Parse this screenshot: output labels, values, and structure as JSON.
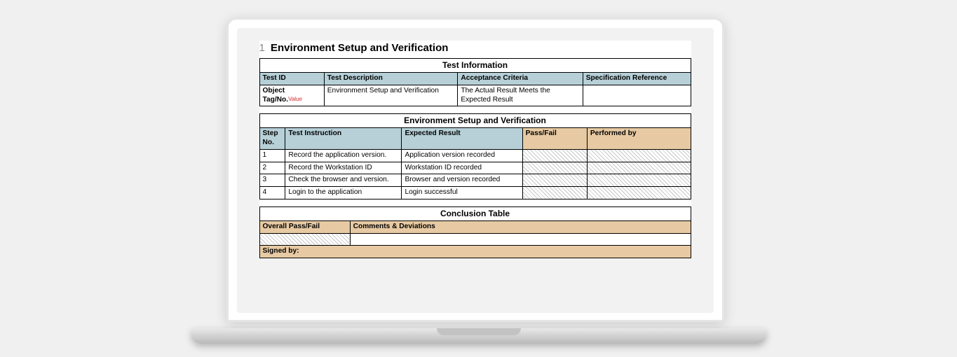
{
  "section": {
    "number": "1",
    "title": "Environment Setup and Verification"
  },
  "tables": {
    "info": {
      "title": "Test Information",
      "headers": {
        "id": "Test ID",
        "desc": "Test Description",
        "crit": "Acceptance Criteria",
        "spec": "Specification Reference"
      },
      "row": {
        "id_line1": "Object",
        "id_line2": "Tag/No.",
        "id_value": "Value",
        "desc": "Environment Setup and Verification",
        "crit": "The Actual Result Meets the Expected Result",
        "spec": ""
      }
    },
    "steps": {
      "title": "Environment Setup and Verification",
      "headers": {
        "no": "Step No.",
        "instr": "Test Instruction",
        "exp": "Expected Result",
        "pf": "Pass/Fail",
        "by": "Performed by"
      },
      "rows": [
        {
          "no": "1",
          "instr": "Record the application version.",
          "exp": "Application version recorded"
        },
        {
          "no": "2",
          "instr": "Record the Workstation ID",
          "exp": "Workstation ID recorded"
        },
        {
          "no": "3",
          "instr": "Check the browser and version.",
          "exp": "Browser and version recorded"
        },
        {
          "no": "4",
          "instr": "Login to the application",
          "exp": "Login successful"
        }
      ]
    },
    "conclusion": {
      "title": "Conclusion Table",
      "headers": {
        "overall": "Overall Pass/Fail",
        "comments": "Comments & Deviations"
      },
      "signed": "Signed by:"
    }
  }
}
